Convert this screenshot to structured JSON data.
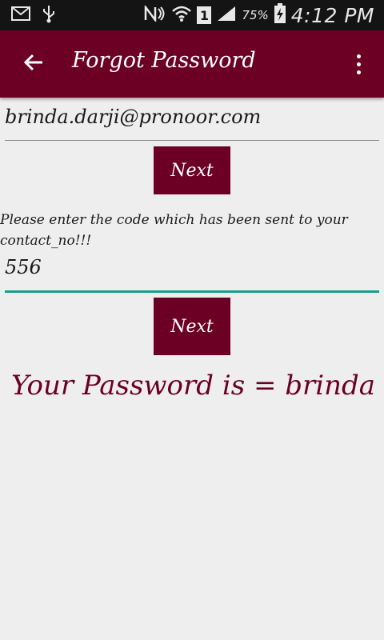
{
  "status_bar": {
    "battery_percent": "75%",
    "sim_slot": "1",
    "time": "4:12 PM",
    "icons": [
      "mail-icon",
      "usb-icon",
      "nfc-icon",
      "wifi-icon",
      "sim-icon",
      "signal-icon",
      "battery-charging-icon"
    ]
  },
  "app_bar": {
    "title": "Forgot Password",
    "background_color": "#6b0024",
    "back_icon": "arrow-left-icon",
    "menu_icon": "more-vert-icon"
  },
  "form": {
    "email_value": "brinda.darji@pronoor.com",
    "next_label_1": "Next",
    "prompt_text": "Please enter the code which has been sent to your contact_no!!!",
    "code_value": "556",
    "next_label_2": "Next",
    "result_text": "Your Password is = brinda"
  },
  "colors": {
    "accent": "#6b0024",
    "focus_underline": "#1a9a8a",
    "background": "#eeeeee"
  }
}
